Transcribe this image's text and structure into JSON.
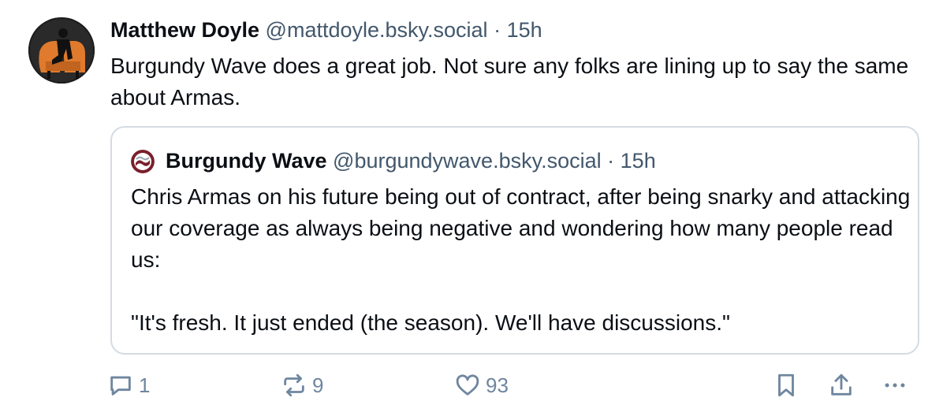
{
  "post": {
    "author_name": "Matthew Doyle",
    "author_handle": "@mattdoyle.bsky.social",
    "separator": "·",
    "time": "15h",
    "text": "Burgundy Wave does a great job. Not sure any folks are lining up to say the same about Armas."
  },
  "quote": {
    "author_name": "Burgundy Wave",
    "author_handle": "@burgundywave.bsky.social",
    "separator": "·",
    "time": "15h",
    "text": "Chris Armas on his future being out of contract, after being snarky and attacking  our coverage as always being negative and wondering how many people read us:\n\n\"It's fresh. It just ended (the season). We'll have discussions.\""
  },
  "actions": {
    "reply_count": "1",
    "repost_count": "9",
    "like_count": "93",
    "icons": [
      "reply-icon",
      "repost-icon",
      "like-icon",
      "bookmark-icon",
      "share-icon",
      "more-icon"
    ]
  },
  "colors": {
    "text": "#0b0f14",
    "secondary": "#42576c",
    "action": "#6f869f",
    "border": "#d4dbe2",
    "avatar_chair": "#e07a2c",
    "burgundy": "#7a1f2b"
  }
}
